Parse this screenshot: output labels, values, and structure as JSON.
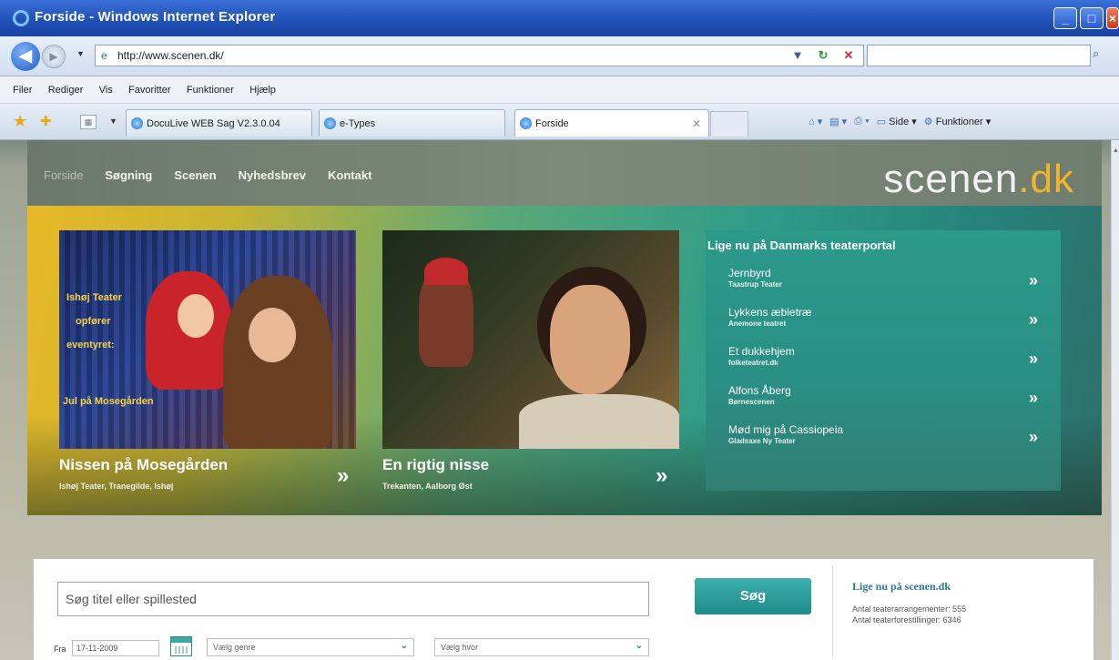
{
  "window": {
    "title": "Forside - Windows Internet Explorer",
    "controls": [
      "_",
      "□",
      "×"
    ]
  },
  "addressbar": {
    "url": "http://www.scenen.dk/",
    "search_value": ""
  },
  "menu": [
    "Filer",
    "Rediger",
    "Vis",
    "Favoritter",
    "Funktioner",
    "Hjælp"
  ],
  "tabs": [
    {
      "label": "DocuLive WEB Sag V2.3.0.04",
      "active": false
    },
    {
      "label": "e-Types",
      "active": false
    },
    {
      "label": "Forside",
      "active": true
    }
  ],
  "commandbar": {
    "page_label": "Side",
    "tools_label": "Funktioner"
  },
  "site": {
    "logo_main": "scenen",
    "logo_dot": ".dk",
    "nav": [
      "Forside",
      "Søgning",
      "Scenen",
      "Nyhedsbrev",
      "Kontakt"
    ]
  },
  "features": [
    {
      "title": "Nissen på Mosegården",
      "subtitle": "Ishøj Teater, Tranegilde, Ishøj",
      "image_caption": [
        "Ishøj Teater",
        "opfører",
        "eventyret:",
        "Jul på Mosegården"
      ]
    },
    {
      "title": "En rigtig nisse",
      "subtitle": "Trekanten, Aalborg Øst"
    }
  ],
  "now_panel": {
    "heading": "Lige nu på Danmarks teaterportal",
    "items": [
      {
        "title": "Jernbyrd",
        "venue": "Taastrup Teater"
      },
      {
        "title": "Lykkens æbletræ",
        "venue": "Anemone teatret"
      },
      {
        "title": "Et dukkehjem",
        "venue": "folketeatret.dk"
      },
      {
        "title": "Alfons Åberg",
        "venue": "Børnescenen"
      },
      {
        "title": "Mød mig på Cassiopeia",
        "venue": "Gladsaxe Ny Teater"
      }
    ]
  },
  "search": {
    "placeholder": "Søg titel eller spillested",
    "button": "Søg",
    "from_label": "Fra",
    "date_value": "17-11-2009",
    "genre_placeholder": "Vælg genre",
    "where_placeholder": "Vælg hvor"
  },
  "stats": {
    "title": "Lige nu på scenen.dk",
    "events_label": "Antal teaterarrangementer: 555",
    "shows_label": "Antal teaterforestillinger: 6346"
  },
  "icons": {
    "arrow": "»",
    "select_chevron": "⌄"
  },
  "colors": {
    "accent_teal": "#1f8b8a",
    "logo_orange": "#f2b52a",
    "ie_titlebar": "#1f4fb5"
  }
}
